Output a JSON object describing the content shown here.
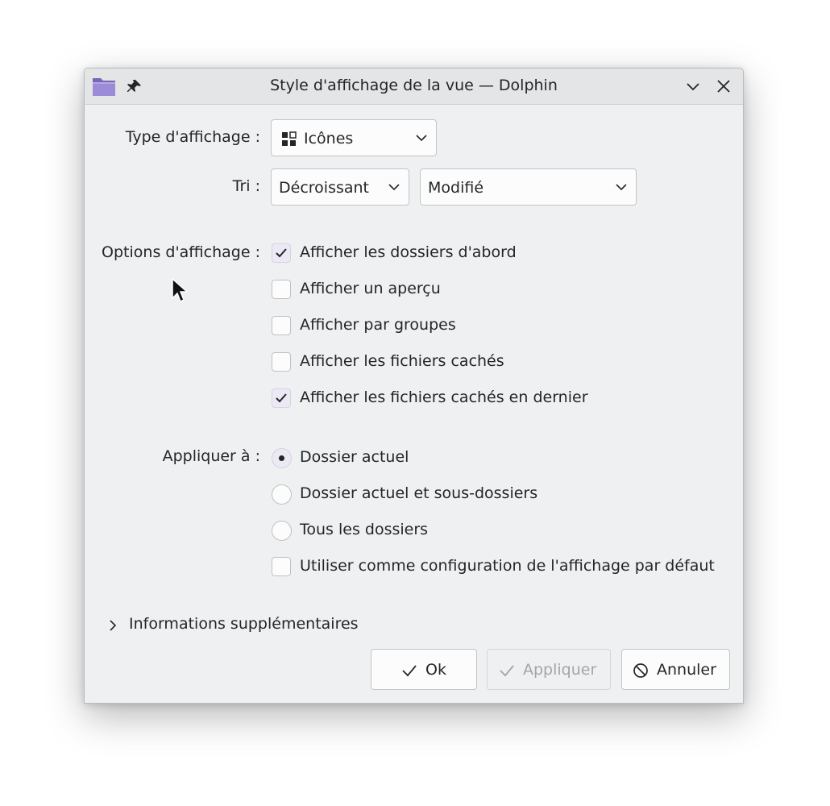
{
  "window": {
    "title": "Style d'affichage de la vue — Dolphin"
  },
  "view_type": {
    "label": "Type d'affichage :",
    "value": "Icônes"
  },
  "sort": {
    "label": "Tri :",
    "order": "Décroissant",
    "field": "Modifié"
  },
  "display_options": {
    "label": "Options d'affichage :",
    "items": [
      {
        "label": "Afficher les dossiers d'abord",
        "checked": true
      },
      {
        "label": "Afficher un aperçu",
        "checked": false
      },
      {
        "label": "Afficher par groupes",
        "checked": false
      },
      {
        "label": "Afficher les fichiers cachés",
        "checked": false
      },
      {
        "label": "Afficher les fichiers cachés en dernier",
        "checked": true
      }
    ]
  },
  "apply_to": {
    "label": "Appliquer à :",
    "options": [
      {
        "label": "Dossier actuel",
        "selected": true
      },
      {
        "label": "Dossier actuel et sous-dossiers",
        "selected": false
      },
      {
        "label": "Tous les dossiers",
        "selected": false
      }
    ],
    "default_checkbox": {
      "label": "Utiliser comme configuration de l'affichage par défaut",
      "checked": false
    }
  },
  "expander": {
    "label": "Informations supplémentaires"
  },
  "buttons": {
    "ok": "Ok",
    "apply": "Appliquer",
    "cancel": "Annuler"
  },
  "colors": {
    "window_bg": "#eff0f1",
    "titlebar_bg": "#e3e5e7",
    "folder_icon": "#8a78c7",
    "checked_bg": "#ece9f4",
    "disabled_text": "#a3a5a7"
  }
}
